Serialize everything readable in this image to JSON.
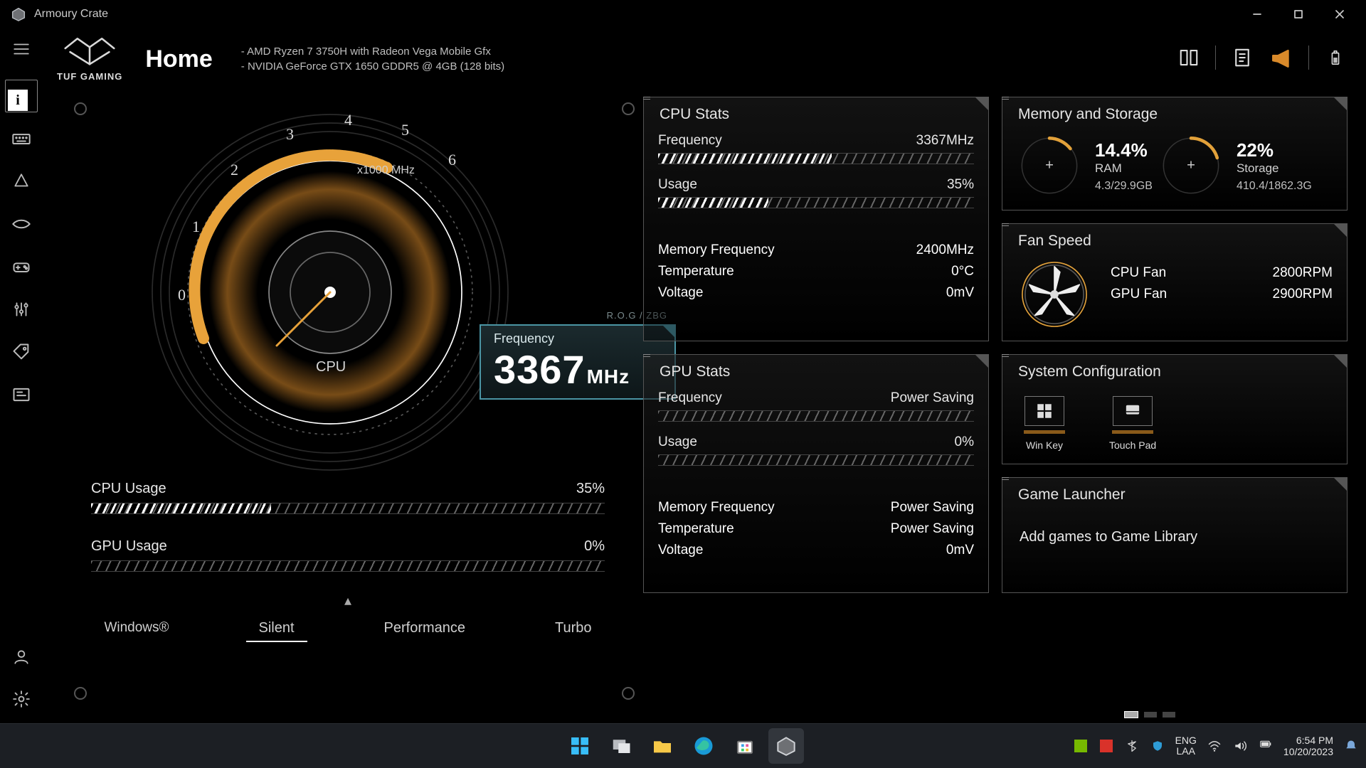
{
  "app_title": "Armoury Crate",
  "logo_caption": "TUF GAMING",
  "page_title": "Home",
  "specs": [
    "AMD Ryzen 7 3750H with Radeon Vega Mobile Gfx",
    "NVIDIA GeForce GTX 1650 GDDR5 @ 4GB (128 bits)"
  ],
  "gauge": {
    "unit_label": "x1000 MHz",
    "center_label": "CPU",
    "ticks": [
      "0",
      "1",
      "2",
      "3",
      "4",
      "5",
      "6"
    ],
    "readout_minor": "R.O.G / ZBG",
    "readout_label": "Frequency",
    "readout_value": "3367",
    "readout_unit": "MHz"
  },
  "left_usage": {
    "cpu": {
      "label": "CPU Usage",
      "value": "35%",
      "fill": 35
    },
    "gpu": {
      "label": "GPU Usage",
      "value": "0%",
      "fill": 0
    }
  },
  "modes": {
    "items": [
      "Windows®",
      "Silent",
      "Performance",
      "Turbo"
    ],
    "active": 1
  },
  "panels": {
    "cpu": {
      "title": "CPU Stats",
      "rows": [
        {
          "label": "Frequency",
          "value": "3367MHz",
          "bar": 55
        },
        {
          "label": "Usage",
          "value": "35%",
          "bar": 35
        }
      ],
      "lines": [
        {
          "label": "Memory Frequency",
          "value": "2400MHz"
        },
        {
          "label": "Temperature",
          "value": "0°C"
        },
        {
          "label": "Voltage",
          "value": "0mV"
        }
      ]
    },
    "gpu": {
      "title": "GPU Stats",
      "rows": [
        {
          "label": "Frequency",
          "value": "Power Saving",
          "bar": 0
        },
        {
          "label": "Usage",
          "value": "0%",
          "bar": 0
        }
      ],
      "lines": [
        {
          "label": "Memory Frequency",
          "value": "Power Saving"
        },
        {
          "label": "Temperature",
          "value": "Power Saving"
        },
        {
          "label": "Voltage",
          "value": "0mV"
        }
      ]
    },
    "mem": {
      "title": "Memory and Storage",
      "ram": {
        "pct": "14.4%",
        "label": "RAM",
        "sub": "4.3/29.9GB",
        "fill": 14.4
      },
      "storage": {
        "pct": "22%",
        "label": "Storage",
        "sub": "410.4/1862.3G",
        "fill": 22
      }
    },
    "fan": {
      "title": "Fan Speed",
      "rows": [
        {
          "label": "CPU Fan",
          "value": "2800RPM"
        },
        {
          "label": "GPU Fan",
          "value": "2900RPM"
        }
      ]
    },
    "syscfg": {
      "title": "System Configuration",
      "items": [
        {
          "name": "win-key",
          "label": "Win Key"
        },
        {
          "name": "touchpad",
          "label": "Touch Pad"
        }
      ]
    },
    "launcher": {
      "title": "Game Launcher",
      "text": "Add games to Game Library"
    }
  },
  "taskbar": {
    "lang1": "ENG",
    "lang2": "LAA",
    "time": "6:54 PM",
    "date": "10/20/2023"
  }
}
